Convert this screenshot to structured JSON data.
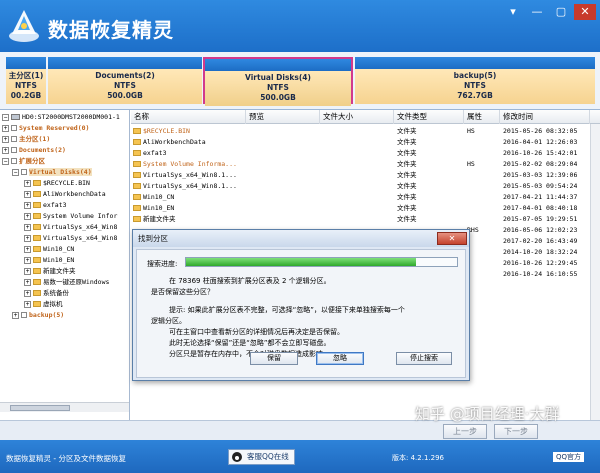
{
  "app": {
    "title": "数据恢复精灵",
    "window_buttons": [
      "▾",
      "—",
      "▢",
      "✕"
    ]
  },
  "partitions": [
    {
      "name": "主分区(1)",
      "fs": "NTFS",
      "size": "00.2GB"
    },
    {
      "name": "Documents(2)",
      "fs": "NTFS",
      "size": "500.0GB"
    },
    {
      "name": "Virtual Disks(4)",
      "fs": "NTFS",
      "size": "500.0GB"
    },
    {
      "name": "backup(5)",
      "fs": "NTFS",
      "size": "762.7GB"
    }
  ],
  "tree": [
    {
      "label": "HD0:ST2000DMST2000DM001-1",
      "indent": 0
    },
    {
      "label": "System Reserved(0)",
      "indent": 1,
      "orange": true
    },
    {
      "label": "主分区(1)",
      "indent": 1,
      "orange": true
    },
    {
      "label": "Documents(2)",
      "indent": 1,
      "orange": true
    },
    {
      "label": "扩展分区",
      "indent": 1,
      "orange": true
    },
    {
      "label": "Virtual Disks(4)",
      "indent": 2,
      "orange": true,
      "selected": true
    },
    {
      "label": "$RECYCLE.BIN",
      "indent": 3
    },
    {
      "label": "AliWorkbenchData",
      "indent": 3
    },
    {
      "label": "exfat3",
      "indent": 3
    },
    {
      "label": "System Volume Infor",
      "indent": 3
    },
    {
      "label": "VirtualSys_x64_Win8",
      "indent": 3
    },
    {
      "label": "VirtualSys_x64_Win8",
      "indent": 3
    },
    {
      "label": "Win10_CN",
      "indent": 3
    },
    {
      "label": "Win10_EN",
      "indent": 3
    },
    {
      "label": "新建文件夹",
      "indent": 3
    },
    {
      "label": "易数一键还原Windows",
      "indent": 3
    },
    {
      "label": "系统备份",
      "indent": 3
    },
    {
      "label": "虚拟机",
      "indent": 3
    },
    {
      "label": "backup(5)",
      "indent": 2,
      "orange": true
    }
  ],
  "columns": [
    "名称",
    "预览",
    "文件大小",
    "文件类型",
    "属性",
    "修改时间"
  ],
  "files": [
    {
      "name": "$RECYCLE.BIN",
      "type": "文件夹",
      "attr": "HS",
      "time": "2015-05-26 08:32:05",
      "orange": true
    },
    {
      "name": "AliWorkbenchData",
      "type": "文件夹",
      "attr": "",
      "time": "2016-04-01 12:26:03"
    },
    {
      "name": "exfat3",
      "type": "文件夹",
      "attr": "",
      "time": "2016-10-26 15:42:01"
    },
    {
      "name": "System Volume Informa...",
      "type": "文件夹",
      "attr": "HS",
      "time": "2015-02-02 08:29:04",
      "orange": true
    },
    {
      "name": "VirtualSys_x64_Win8.1...",
      "type": "文件夹",
      "attr": "",
      "time": "2015-03-03 12:39:06"
    },
    {
      "name": "VirtualSys_x64_Win8.1...",
      "type": "文件夹",
      "attr": "",
      "time": "2015-05-03 09:54:24"
    },
    {
      "name": "Win10_CN",
      "type": "文件夹",
      "attr": "",
      "time": "2017-04-21 11:44:37"
    },
    {
      "name": "Win10_EN",
      "type": "文件夹",
      "attr": "",
      "time": "2017-04-01 08:40:18"
    },
    {
      "name": "新建文件夹",
      "type": "文件夹",
      "attr": "",
      "time": "2015-07-05 19:29:51"
    },
    {
      "name": "",
      "type": "",
      "attr": "RHS",
      "time": "2016-05-06 12:02:23"
    },
    {
      "name": "",
      "type": "",
      "attr": "",
      "time": "2017-02-20 16:43:49"
    },
    {
      "name": "",
      "type": "",
      "attr": "",
      "time": "2014-10-20 18:32:24"
    },
    {
      "name": "",
      "type": "",
      "attr": "",
      "time": "2016-10-26 12:29:45"
    },
    {
      "name": "",
      "type": "",
      "attr": "",
      "time": "2016-10-24 16:10:55"
    }
  ],
  "nav": {
    "prev": "上一步",
    "next": "下一步"
  },
  "status": {
    "text": "数据恢复精灵 - 分区及文件数据恢复",
    "qq": "客服QQ在线",
    "version": "版本: 4.2.1.296",
    "official": "QQ官方"
  },
  "watermark": "知乎 @项目经理·大群",
  "dialog": {
    "title": "找到分区",
    "close": "✕",
    "progress_label": "搜索进度:",
    "progress": 0.85,
    "line1": "在 78369 柱面搜索到扩展分区表及 2 个逻辑分区。",
    "line2": "是否保留这些分区？",
    "line3": "提示: 如果此扩展分区表不完整，可选择“忽略”，以便接下来单独搜索每一个",
    "line4": "逻辑分区。",
    "line5": "可在主窗口中查看新分区的详细情况后再决定是否保留。",
    "line6": "此时无论选择“保留”还是“忽略”都不会立即写磁盘。",
    "line7": "分区只是暂存在内存中，不会对磁盘数据造成影响。",
    "keep": "保留",
    "ignore": "忽略",
    "stop": "停止搜索"
  }
}
